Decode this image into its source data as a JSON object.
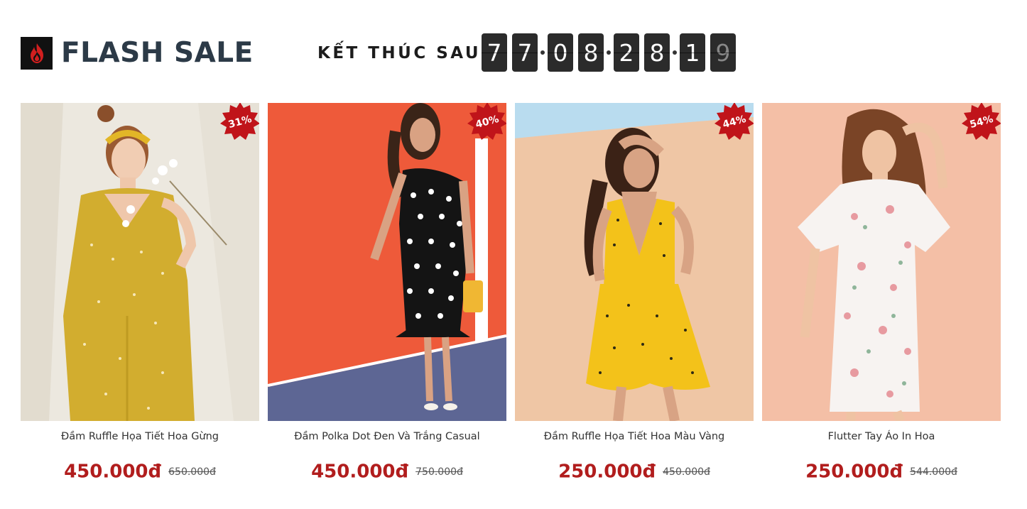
{
  "header": {
    "title": "FLASH SALE",
    "logo_icon": "flame-icon",
    "countdown_label": "KẾT THÚC SAU",
    "timer_digits": [
      "7",
      "7",
      "0",
      "8",
      "2",
      "8",
      "1",
      "9"
    ]
  },
  "colors": {
    "title": "#2c3a47",
    "price": "#b11d1d",
    "badge": "#c0141a",
    "timer_bg": "#2b2b2b"
  },
  "products": [
    {
      "name": "Đầm Ruffle Họa Tiết Hoa Gừng",
      "price": "450.000đ",
      "old_price": "650.000đ",
      "discount": "31%"
    },
    {
      "name": "Đầm Polka Dot Đen Và Trắng Casual",
      "price": "450.000đ",
      "old_price": "750.000đ",
      "discount": "40%"
    },
    {
      "name": "Đầm Ruffle Họa Tiết Hoa Màu Vàng",
      "price": "250.000đ",
      "old_price": "450.000đ",
      "discount": "44%"
    },
    {
      "name": "Flutter Tay Áo In Hoa",
      "price": "250.000đ",
      "old_price": "544.000đ",
      "discount": "54%"
    }
  ]
}
